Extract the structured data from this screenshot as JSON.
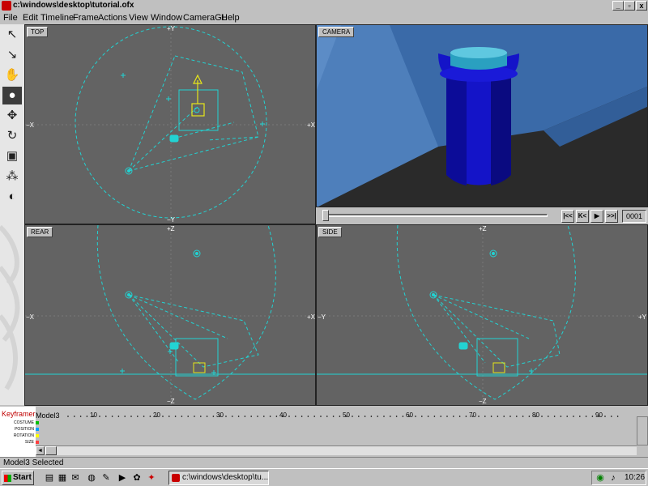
{
  "window": {
    "title": "c:\\windows\\desktop\\tutorial.ofx",
    "buttons": [
      "_",
      "▫",
      "x"
    ]
  },
  "menu": [
    "File",
    "Edit",
    "Timeline",
    "Frame",
    "Actions",
    "View",
    "Window",
    "CameraGL",
    "Help"
  ],
  "toolbar": {
    "tools": [
      {
        "icon": "select-arrow-icon",
        "glyph": "↖"
      },
      {
        "icon": "select-arrow-alt-icon",
        "glyph": "↘"
      },
      {
        "icon": "hand-pan-icon",
        "glyph": "✋"
      },
      {
        "icon": "light-icon",
        "glyph": "●"
      },
      {
        "icon": "move-icon",
        "glyph": "✥"
      },
      {
        "icon": "rotate-icon",
        "glyph": "↻"
      },
      {
        "icon": "frame-icon",
        "glyph": "▣"
      },
      {
        "icon": "shapes-icon",
        "glyph": "⁂"
      },
      {
        "icon": "sphere-icon",
        "glyph": "◐"
      }
    ]
  },
  "viewports": {
    "top": {
      "label": "TOP",
      "axis_top": "+Y",
      "axis_bottom": "−Y",
      "axis_left": "−X",
      "axis_right": "+X"
    },
    "camera": {
      "label": "CAMERA"
    },
    "rear": {
      "label": "REAR",
      "axis_top": "+Z",
      "axis_bottom": "−Z",
      "axis_left": "−X",
      "axis_right": "+X"
    },
    "side": {
      "label": "SIDE",
      "axis_top": "+Z",
      "axis_bottom": "−Z",
      "axis_left": "−Y",
      "axis_right": "+Y"
    }
  },
  "playback": {
    "buttons": [
      "|<<",
      "K<",
      "▶",
      ">>|"
    ],
    "frame": "0001"
  },
  "timeline": {
    "panel_title": "Keyframer",
    "rows": [
      "COSTUME",
      "POSITION",
      "ROTATION",
      "SIZE"
    ],
    "row_colors": [
      "#00c000",
      "#00a0ff",
      "#ffff00",
      "#ff4040"
    ],
    "model": "Model3",
    "ticks": [
      "10",
      "20",
      "30",
      "40",
      "50",
      "60",
      "70",
      "80",
      "90"
    ]
  },
  "status": {
    "text": "Model3 Selected"
  },
  "taskbar": {
    "start": "Start",
    "quick_icons": [
      "desktop-icon",
      "network-icon",
      "mail-icon",
      "globe-icon",
      "media-icon",
      "folder-icon",
      "app-icon",
      "app-red-icon"
    ],
    "task_item": "c:\\windows\\desktop\\tu...",
    "clock": "10:26"
  },
  "colors": {
    "viewport_bg": "#636363",
    "wire": "#22d3d3",
    "select_box": "#e6e61a",
    "bottle_body": "#1414c8",
    "bottle_cap": "#2aa0c0",
    "wall_blue": "#3a6aa8",
    "floor": "#2a2a2a"
  }
}
